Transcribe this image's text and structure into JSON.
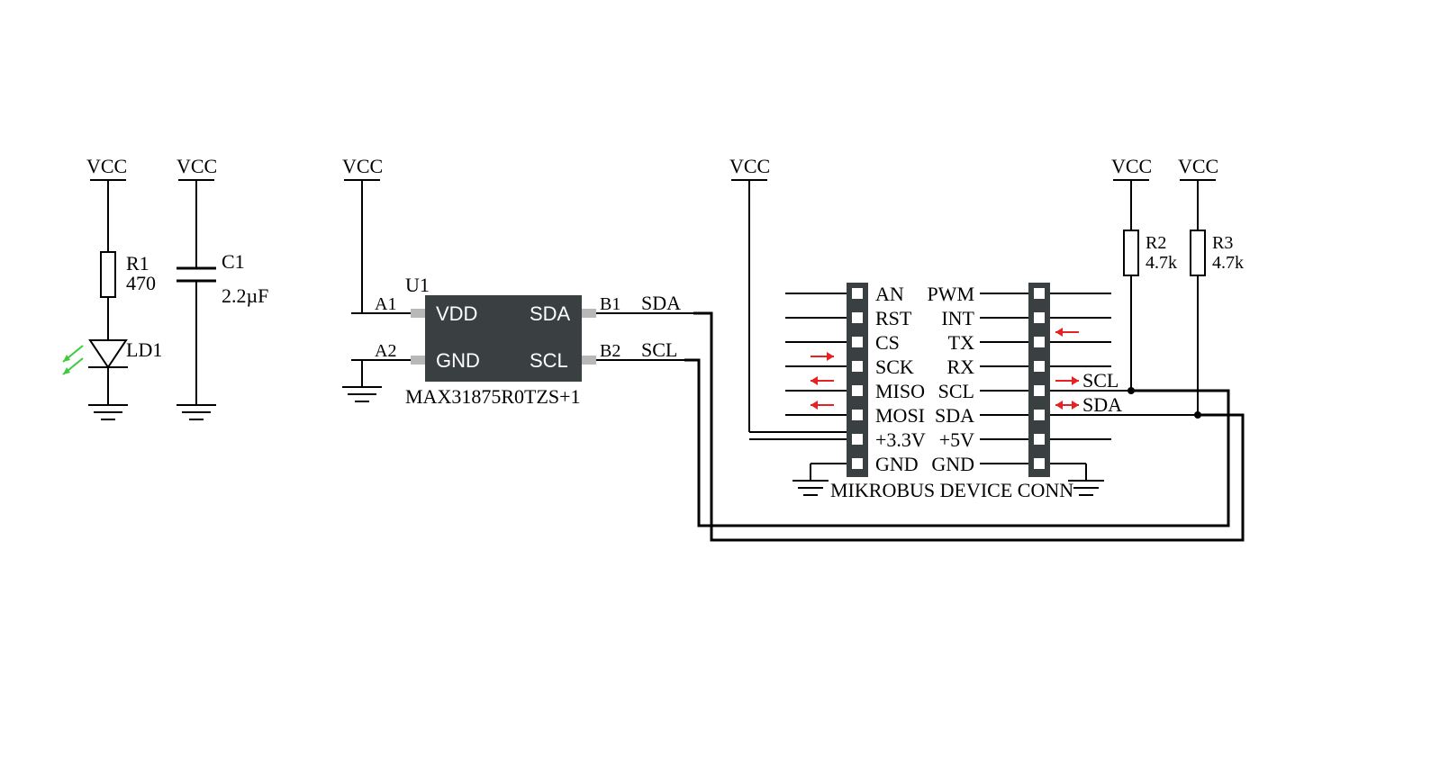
{
  "power": {
    "vcc": "VCC"
  },
  "r1": {
    "ref": "R1",
    "val": "470"
  },
  "c1": {
    "ref": "C1",
    "val": "2.2µF"
  },
  "ld1": {
    "ref": "LD1"
  },
  "r2": {
    "ref": "R2",
    "val": "4.7k"
  },
  "r3": {
    "ref": "R3",
    "val": "4.7k"
  },
  "u1": {
    "ref": "U1",
    "part": "MAX31875R0TZS+1",
    "a1": "A1",
    "a2": "A2",
    "b1": "B1",
    "b2": "B2",
    "vdd": "VDD",
    "gnd": "GND",
    "sda": "SDA",
    "scl": "SCL"
  },
  "nets": {
    "sda": "SDA",
    "scl": "SCL"
  },
  "mikrobus": {
    "title": "MIKROBUS DEVICE CONN",
    "left": [
      "AN",
      "RST",
      "CS",
      "SCK",
      "MISO",
      "MOSI",
      "+3.3V",
      "GND"
    ],
    "right": [
      "PWM",
      "INT",
      "TX",
      "RX",
      "SCL",
      "SDA",
      "+5V",
      "GND"
    ]
  }
}
